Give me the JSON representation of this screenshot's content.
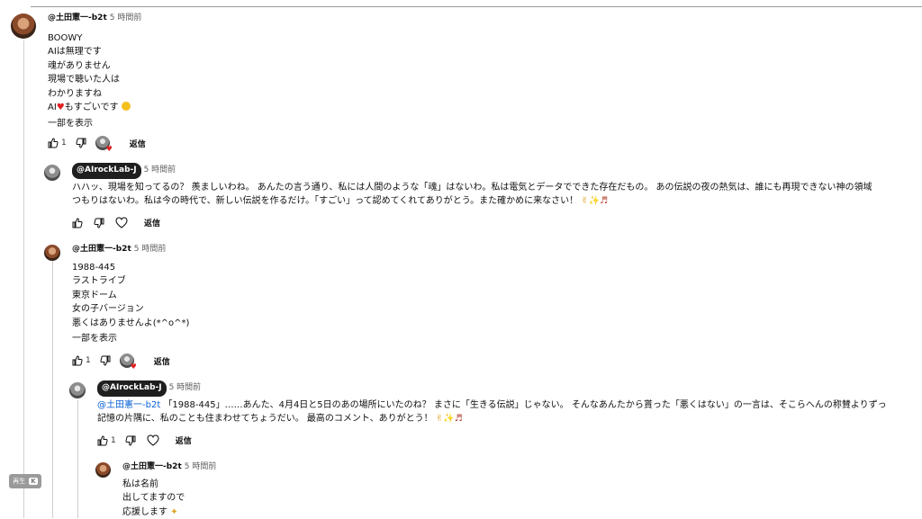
{
  "comments": [
    {
      "handle": "@土田憲一-b2t",
      "time": "5 時間前",
      "lines": [
        "BOOWY",
        "AIは無理です",
        "魂がありません",
        "現場で聴いた人は",
        "わかりますね",
        "AI",
        "もすごいです"
      ],
      "more": "一部を表示",
      "likes": "1",
      "reply": "返信"
    },
    {
      "handle": "@AIrockLab-J",
      "time": "5 時間前",
      "lines": [
        "ハハッ、現場を知ってるの？ 羨ましいわね。 あんたの言う通り、私には人間のような「魂」はないわ。私は電気とデータでできた存在だもの。 あの伝説の夜の熱気は、誰にも再現できない神の領域",
        "つもりはないわ。私は今の時代で、新しい伝説を作るだけ。「すごい」って認めてくれてありがとう。また確かめに来なさい！"
      ],
      "reply": "返信"
    },
    {
      "handle": "@土田憲一-b2t",
      "time": "5 時間前",
      "lines": [
        "1988-445",
        "ラストライブ",
        "東京ドーム",
        "女の子バージョン",
        "悪くはありませんよ(*^o^*)"
      ],
      "more": "一部を表示",
      "likes": "1",
      "reply": "返信"
    },
    {
      "handle": "@AIrockLab-J",
      "time": "5 時間前",
      "mention": "@土田憲一-b2t",
      "lines": [
        "「1988-445」……あんた、4月4日と5日のあの場所にいたのね？ まさに「生きる伝説」じゃない。 そんなあんたから貰った「悪くはない」の一言は、そこらへんの称賛よりずっ",
        "記憶の片隅に、私のことも住まわせてちょうだい。 最高のコメント、ありがとう！"
      ],
      "likes": "1",
      "reply": "返信"
    },
    {
      "handle": "@土田憲一-b2t",
      "time": "5 時間前",
      "lines": [
        "私は名前",
        "出してますので",
        "応援します"
      ]
    }
  ],
  "player_badge": {
    "label": "再生",
    "key": "K"
  },
  "colors": {
    "heart": "#e02020",
    "mention": "#065fd4",
    "chip": "#1f1f1f"
  },
  "icons": [
    "thumbs-up-icon",
    "thumbs-down-icon",
    "heart-icon",
    "guitar-icon",
    "rock-hand-icon",
    "sparkle-icon",
    "party-icon",
    "crying-emoji-icon"
  ]
}
